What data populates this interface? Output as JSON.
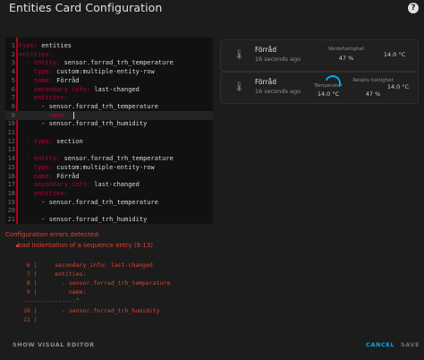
{
  "dialog": {
    "title": "Entities Card Configuration",
    "help_icon": "?"
  },
  "editor": {
    "lines": [
      {
        "n": "1",
        "key": "type:",
        "val": " entities"
      },
      {
        "n": "2",
        "key": "entities:",
        "val": ""
      },
      {
        "n": "3",
        "key": "  - entity:",
        "val": " sensor.forrad_trh_temperature"
      },
      {
        "n": "4",
        "key": "    type:",
        "val": " custom:multiple-entity-row"
      },
      {
        "n": "5",
        "key": "    name:",
        "val": " Förråd"
      },
      {
        "n": "6",
        "key": "    secondary_info:",
        "val": " last-changed"
      },
      {
        "n": "7",
        "key": "    entities:",
        "val": ""
      },
      {
        "n": "8",
        "key": "",
        "val": "      - sensor.forrad_trh_temperature"
      },
      {
        "n": "9",
        "key": "        name:",
        "val": " "
      },
      {
        "n": "10",
        "key": "",
        "val": "      - sensor.forrad_trh_humidity"
      },
      {
        "n": "11",
        "key": "",
        "val": ""
      },
      {
        "n": "12",
        "key": "  - type:",
        "val": " section"
      },
      {
        "n": "13",
        "key": "",
        "val": ""
      },
      {
        "n": "14",
        "key": "  - entity:",
        "val": " sensor.forrad_trh_temperature"
      },
      {
        "n": "15",
        "key": "    type:",
        "val": " custom:multiple-entity-row"
      },
      {
        "n": "16",
        "key": "    name:",
        "val": " Förråd"
      },
      {
        "n": "17",
        "key": "    secondary_info:",
        "val": " last-changed"
      },
      {
        "n": "18",
        "key": "    entities:",
        "val": ""
      },
      {
        "n": "19",
        "key": "",
        "val": "      - sensor.forrad_trh_temperature"
      },
      {
        "n": "20",
        "key": "",
        "val": ""
      },
      {
        "n": "21",
        "key": "",
        "val": "      - sensor.forrad_trh_humidity"
      }
    ]
  },
  "preview": {
    "card1": {
      "name": "Förråd",
      "secondary": "16 seconds ago",
      "col1_head": "Värdefuktighet",
      "col1_val": "47 %",
      "col2_val": "14.0 °C"
    },
    "card2": {
      "name": "Förråd",
      "secondary": "16 seconds ago",
      "col1_head": "Temperatur",
      "col1_val": "14.0 °C",
      "col2_head": "Relativ fuktighet",
      "col2_val": "47 %",
      "col3_val": "14.0 °C"
    }
  },
  "errors": {
    "title": "Configuration errors detected:",
    "item": "bad indentation of a sequence entry (9:13)",
    "snippet": [
      " 6 |     secondary_info: last-changed",
      " 7 |     entities:",
      " 8 |       - sensor.forrad_trh_temperature",
      " 9 |         name:",
      "---------------^",
      "10 |       - sensor.forrad_trh_humidity",
      "11 |"
    ]
  },
  "footer": {
    "show_visual": "SHOW VISUAL EDITOR",
    "cancel": "CANCEL",
    "save": "SAVE"
  },
  "colors": {
    "accent": "#03a9f4",
    "error": "#db4437",
    "yaml_key": "#b3003f"
  },
  "icons": {
    "help": "help-circle-icon",
    "thermometer": "thermometer-icon"
  }
}
